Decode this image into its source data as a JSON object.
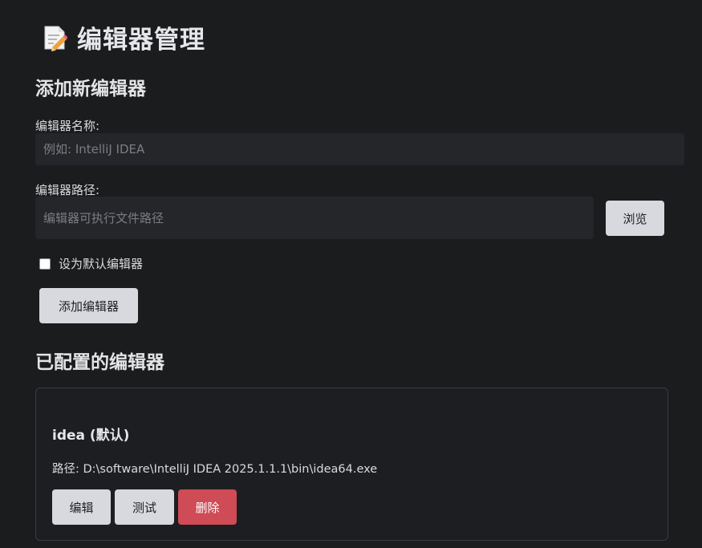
{
  "header": {
    "title": "编辑器管理",
    "icon": "memo-icon"
  },
  "add_section": {
    "title": "添加新编辑器",
    "name_label": "编辑器名称:",
    "name_placeholder": "例如: IntelliJ IDEA",
    "name_value": "",
    "path_label": "编辑器路径:",
    "path_placeholder": "编辑器可执行文件路径",
    "path_value": "",
    "browse_label": "浏览",
    "default_checkbox_label": "设为默认编辑器",
    "default_checked": false,
    "add_button_label": "添加编辑器"
  },
  "configured_section": {
    "title": "已配置的编辑器",
    "editors": [
      {
        "name": "idea (默认)",
        "path": "路径: D:\\software\\IntelliJ IDEA 2025.1.1.1\\bin\\idea64.exe",
        "edit_label": "编辑",
        "test_label": "测试",
        "delete_label": "删除"
      }
    ]
  },
  "colors": {
    "background": "#1b1c1e",
    "input_background": "#25262a",
    "button_background": "#d7d9de",
    "danger": "#cf4b55"
  }
}
